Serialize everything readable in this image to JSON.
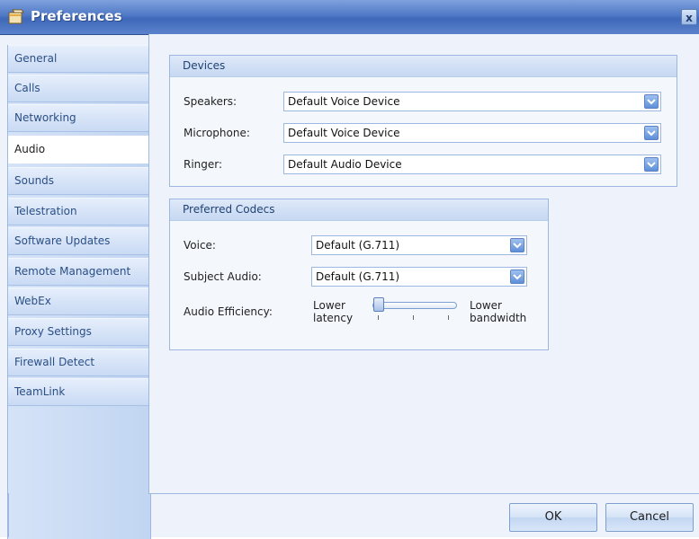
{
  "window": {
    "title": "Preferences",
    "close_label": "x"
  },
  "sidebar": {
    "items": [
      {
        "label": "General"
      },
      {
        "label": "Calls"
      },
      {
        "label": "Networking"
      },
      {
        "label": "Audio"
      },
      {
        "label": "Sounds"
      },
      {
        "label": "Telestration"
      },
      {
        "label": "Software Updates"
      },
      {
        "label": "Remote Management"
      },
      {
        "label": "WebEx"
      },
      {
        "label": "Proxy Settings"
      },
      {
        "label": "Firewall Detect"
      },
      {
        "label": "TeamLink"
      }
    ],
    "active_item": "Audio"
  },
  "devices": {
    "header": "Devices",
    "speakers": {
      "label": "Speakers:",
      "value": "Default Voice Device"
    },
    "microphone": {
      "label": "Microphone:",
      "value": "Default Voice Device"
    },
    "ringer": {
      "label": "Ringer:",
      "value": "Default Audio Device"
    }
  },
  "codecs": {
    "header": "Preferred Codecs",
    "voice": {
      "label": "Voice:",
      "value": "Default (G.711)"
    },
    "subject_audio": {
      "label": "Subject Audio:",
      "value": "Default (G.711)"
    },
    "audio_efficiency": {
      "label": "Audio Efficiency:",
      "low_label_line1": "Lower",
      "low_label_line2": "latency",
      "high_label_line1": "Lower",
      "high_label_line2": "bandwidth",
      "slider_value": 0
    }
  },
  "buttons": {
    "ok": "OK",
    "cancel": "Cancel"
  },
  "colors": {
    "title_bar": "#4f79c6",
    "accent": "#9db7e0",
    "panel": "#eef3fb"
  }
}
